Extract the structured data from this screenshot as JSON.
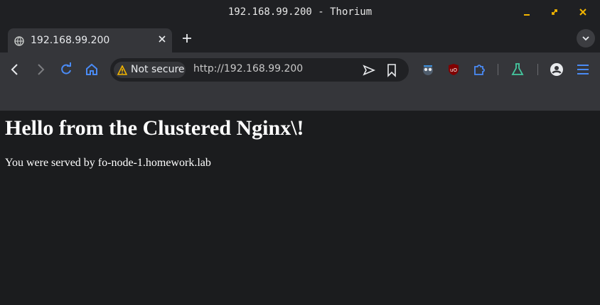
{
  "window": {
    "title": "192.168.99.200 - Thorium"
  },
  "tab": {
    "title": "192.168.99.200"
  },
  "omnibox": {
    "security_label": "Not secure",
    "url": "http://192.168.99.200"
  },
  "page": {
    "heading": "Hello from the Clustered Nginx\\!",
    "body": "You were served by fo-node-1.homework.lab"
  },
  "colors": {
    "accent": "#1a73e8",
    "warning": "#f3b500",
    "page_bg": "#1b1c1e"
  },
  "icons": [
    "minimize-icon",
    "maximize-icon",
    "close-icon",
    "globe-icon",
    "tab-close-icon",
    "plus-icon",
    "chevron-down-icon",
    "back-arrow-icon",
    "forward-arrow-icon",
    "reload-icon",
    "home-icon",
    "warning-icon",
    "send-icon",
    "bookmark-icon",
    "extension-robot-icon",
    "ublock-icon",
    "puzzle-icon",
    "flask-icon",
    "profile-icon",
    "menu-icon"
  ]
}
